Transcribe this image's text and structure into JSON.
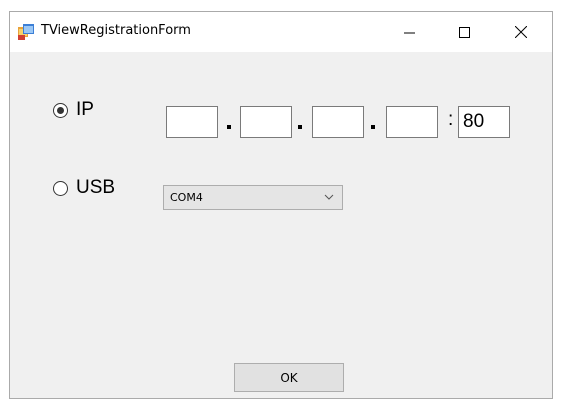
{
  "window": {
    "title": "TViewRegistrationForm"
  },
  "connection": {
    "ip": {
      "label": "IP",
      "selected": true,
      "octets": [
        "",
        "",
        "",
        ""
      ],
      "separator": ".",
      "port_separator": ":",
      "port": "80"
    },
    "usb": {
      "label": "USB",
      "selected": false,
      "port_value": "COM4"
    }
  },
  "ok_button_label": "OK",
  "icons": {
    "app": "app-window-icon",
    "minimize": "minimize-icon",
    "maximize": "maximize-icon",
    "close": "close-icon",
    "dropdown": "chevron-down-icon"
  }
}
